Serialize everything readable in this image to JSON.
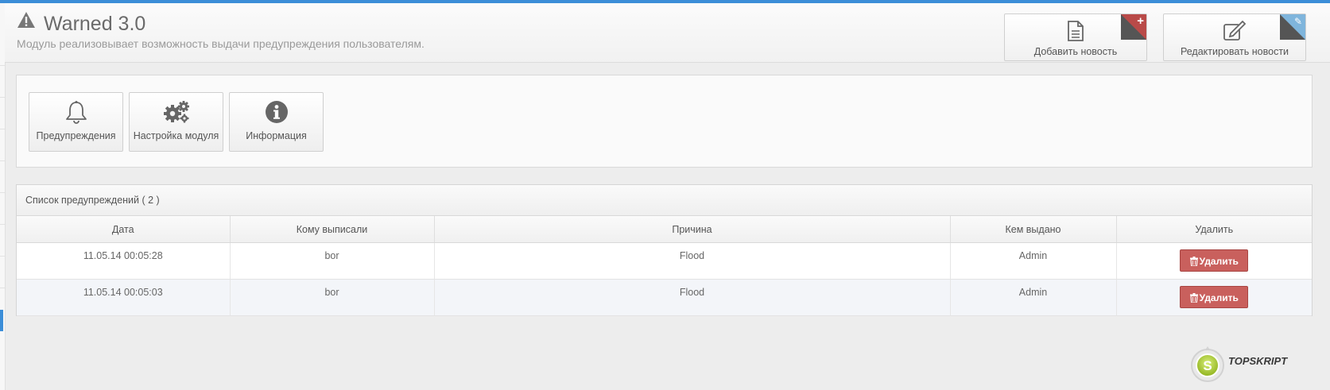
{
  "header": {
    "title": "Warned 3.0",
    "description": "Модуль реализовывает возможность выдачи предупреждения пользователям.",
    "buttons": [
      {
        "label": "Добавить новость",
        "icon": "document-icon",
        "corner_icon": "plus-icon",
        "corner_color": "#b94a48"
      },
      {
        "label": "Редактировать новости",
        "icon": "edit-icon",
        "corner_icon": "pencil-icon",
        "corner_color": "#7fb5dc"
      }
    ]
  },
  "toolbar": {
    "items": [
      {
        "label": "Предупреждения",
        "icon": "bell-icon"
      },
      {
        "label": "Настройка модуля",
        "icon": "gears-icon"
      },
      {
        "label": "Информация",
        "icon": "info-icon"
      }
    ]
  },
  "warnings": {
    "title": "Список предупреждений ( 2 )",
    "columns": [
      "Дата",
      "Кому выписали",
      "Причина",
      "Кем выдано",
      "Удалить"
    ],
    "rows": [
      {
        "date": "11.05.14 00:05:28",
        "to": "bor",
        "reason": "Flood",
        "by": "Admin",
        "action": "Удалить"
      },
      {
        "date": "11.05.14 00:05:03",
        "to": "bor",
        "reason": "Flood",
        "by": "Admin",
        "action": "Удалить"
      }
    ]
  },
  "watermark": {
    "brand": "TOPSKRIPT",
    "letter": "S"
  },
  "colors": {
    "accent": "#3c8ed8",
    "danger": "#c9605d"
  }
}
